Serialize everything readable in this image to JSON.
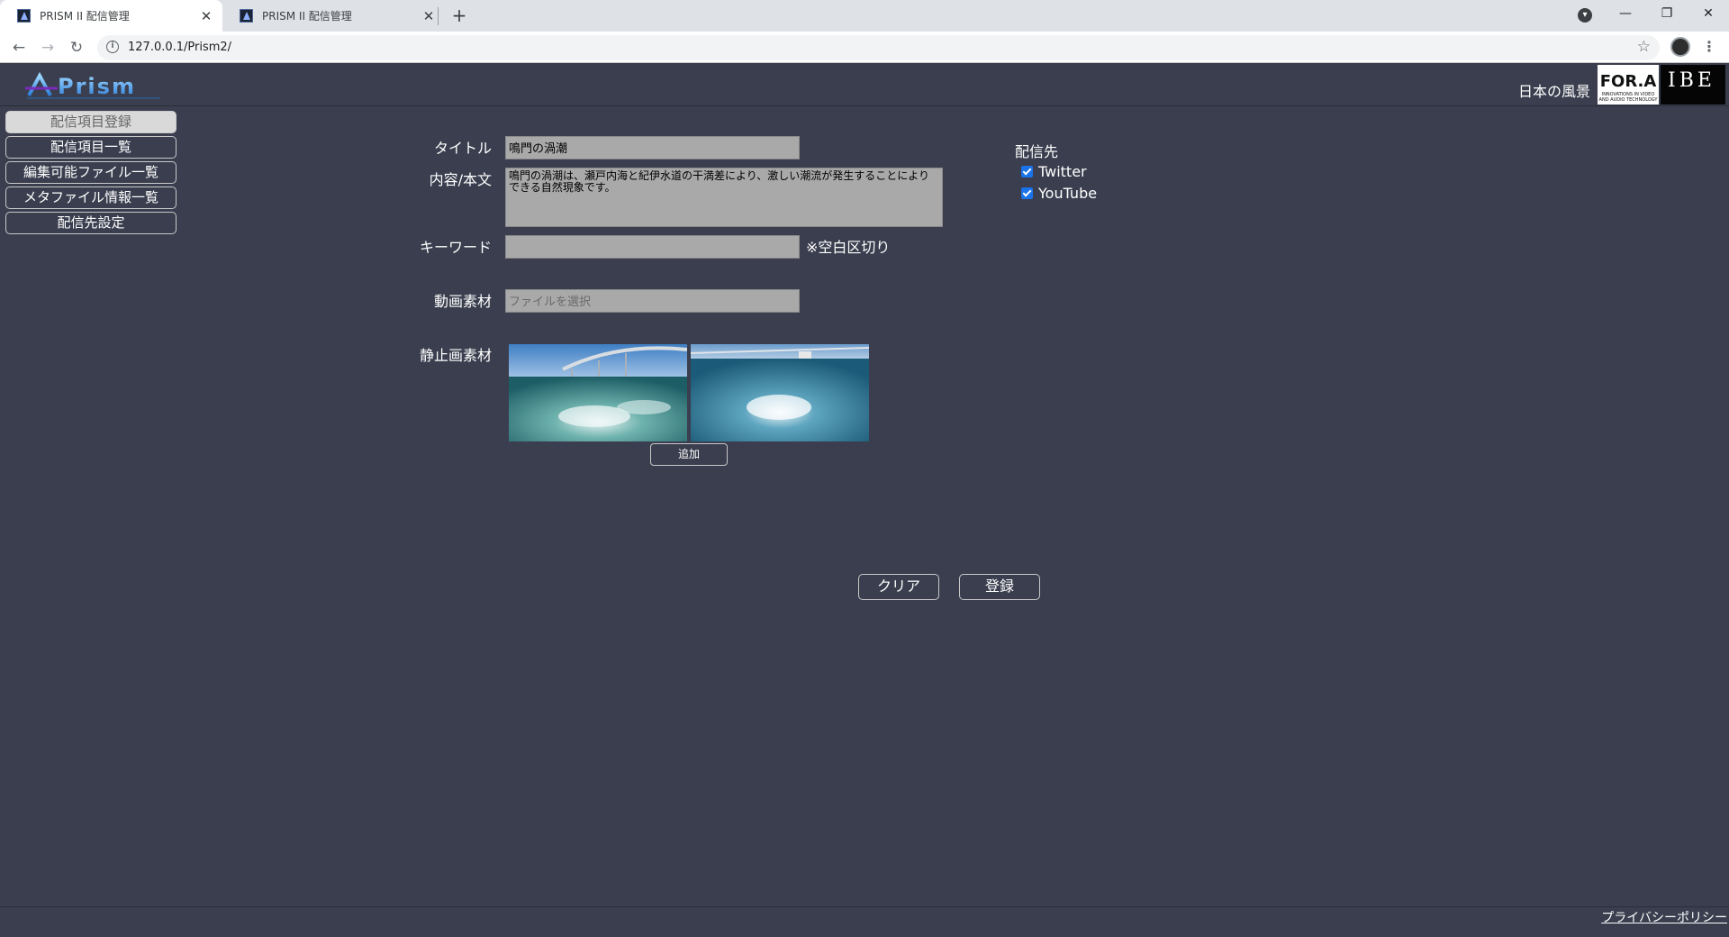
{
  "browser": {
    "tabs": [
      {
        "title": "PRISM II 配信管理",
        "active": true
      },
      {
        "title": "PRISM II 配信管理",
        "active": false
      }
    ],
    "url": "127.0.0.1/Prism2/"
  },
  "header": {
    "logo_text": "APrism",
    "scene_label": "日本の風景",
    "fora_text": "FOR.A",
    "fora_tagline": "INNOVATIONS IN VIDEO AND AUDIO TECHNOLOGY",
    "ibe_text": "IBE"
  },
  "sidebar": {
    "items": [
      {
        "label": "配信項目登録",
        "active": true
      },
      {
        "label": "配信項目一覧",
        "active": false
      },
      {
        "label": "編集可能ファイル一覧",
        "active": false
      },
      {
        "label": "メタファイル情報一覧",
        "active": false
      },
      {
        "label": "配信先設定",
        "active": false
      }
    ]
  },
  "form": {
    "title_label": "タイトル",
    "title_value": "鳴門の渦潮",
    "content_label": "内容/本文",
    "content_value": "鳴門の渦潮は、瀬戸内海と紀伊水道の干満差により、激しい潮流が発生することによりできる自然現象です。",
    "keyword_label": "キーワード",
    "keyword_value": "",
    "keyword_hint": "※空白区切り",
    "video_label": "動画素材",
    "video_placeholder": "ファイルを選択",
    "image_label": "静止画素材",
    "add_button": "追加",
    "clear_button": "クリア",
    "submit_button": "登録"
  },
  "destinations": {
    "title": "配信先",
    "items": [
      {
        "label": "Twitter",
        "checked": true
      },
      {
        "label": "YouTube",
        "checked": true
      }
    ]
  },
  "footer": {
    "privacy_link": "プライバシーポリシー"
  },
  "colors": {
    "page_bg": "#3a3e4e",
    "field_bg": "#a9a9a9",
    "checkbox": "#1a73e8"
  }
}
